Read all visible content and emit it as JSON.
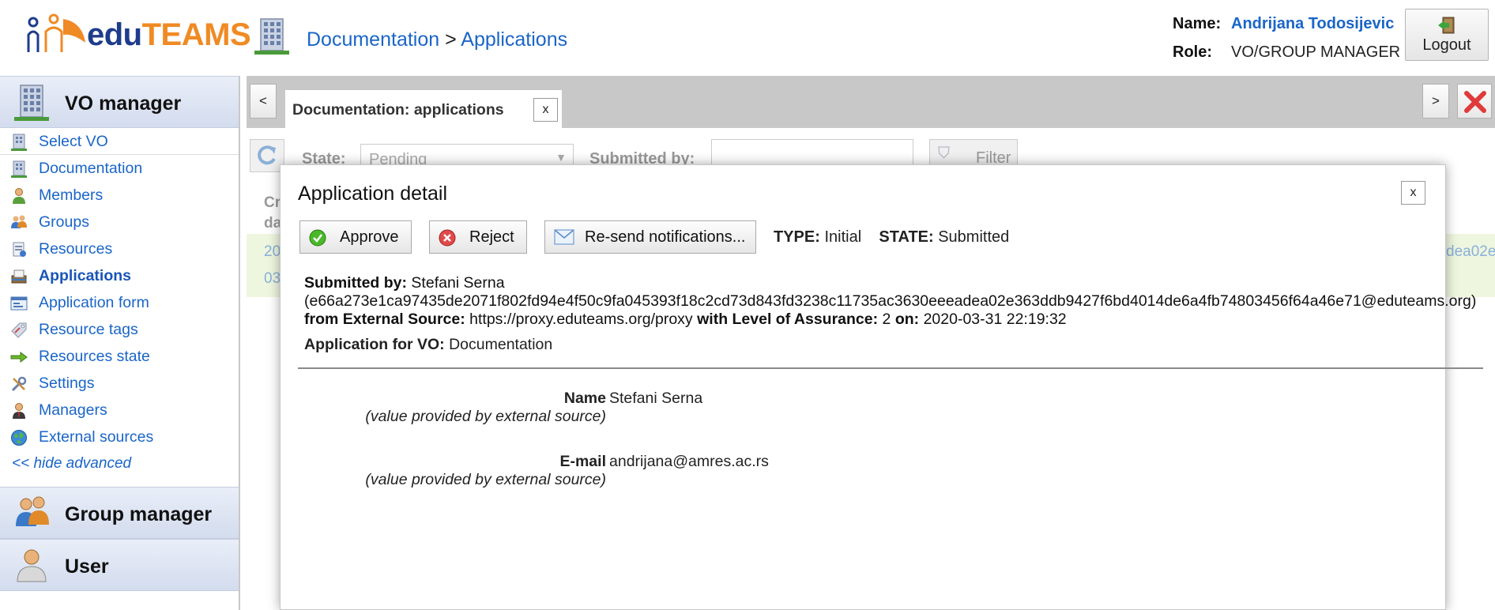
{
  "header": {
    "logo_edu": "edu",
    "logo_teams": "TEAMS",
    "breadcrumb_first": "Documentation",
    "breadcrumb_sep": ">",
    "breadcrumb_second": "Applications",
    "name_label": "Name:",
    "name_value": "Andrijana Todosijevic",
    "role_label": "Role:",
    "role_value": "VO/GROUP MANAGER",
    "logout_label": "Logout"
  },
  "sidebar": {
    "vo_manager": "VO manager",
    "items": [
      {
        "label": "Select VO",
        "icon": "building-icon"
      },
      {
        "label": "Documentation",
        "icon": "building-icon"
      },
      {
        "label": "Members",
        "icon": "user-icon"
      },
      {
        "label": "Groups",
        "icon": "group-icon"
      },
      {
        "label": "Resources",
        "icon": "resource-icon"
      },
      {
        "label": "Applications",
        "icon": "inbox-icon"
      },
      {
        "label": "Application form",
        "icon": "form-icon"
      },
      {
        "label": "Resource tags",
        "icon": "tag-icon"
      },
      {
        "label": "Resources state",
        "icon": "arrow-icon"
      },
      {
        "label": "Settings",
        "icon": "tools-icon"
      },
      {
        "label": "Managers",
        "icon": "manager-icon"
      },
      {
        "label": "External sources",
        "icon": "globe-icon"
      }
    ],
    "hide_advanced": "<< hide advanced",
    "group_manager": "Group manager",
    "user": "User"
  },
  "tabs": {
    "prev": "<",
    "next": ">",
    "active_tab": "Documentation: applications",
    "tab_close": "x"
  },
  "background": {
    "state_label": "State:",
    "state_value": "Pending",
    "submitted_by_label": "Submitted by:",
    "filter_label": "Filter",
    "col_header_1": "Cr",
    "col_header_2": "da",
    "row_c1": "20",
    "row_c2": "03",
    "row_right": "dea02e"
  },
  "modal": {
    "title": "Application detail",
    "close": "x",
    "approve": "Approve",
    "reject": "Reject",
    "resend": "Re-send notifications...",
    "type_label": "TYPE:",
    "type_value": "Initial",
    "state_label": "STATE:",
    "state_value": "Submitted",
    "submitted_by_label": "Submitted by:",
    "submitted_by_value": "Stefani Serna",
    "submitted_id": "(e66a273e1ca97435de2071f802fd94e4f50c9fa045393f18c2cd73d843fd3238c11735ac3630eeeadea02e363ddb9427f6bd4014de6a4fb74803456f64a46e71@eduteams.org)",
    "from_source_label": "from External Source:",
    "from_source_value": "https://proxy.eduteams.org/proxy",
    "loa_label": "with Level of Assurance:",
    "loa_value": "2",
    "on_label": "on:",
    "on_value": "2020-03-31 22:19:32",
    "app_for_vo_label": "Application for VO:",
    "app_for_vo_value": "Documentation",
    "fields": [
      {
        "label": "Name",
        "hint": "(value provided by external source)",
        "value": "Stefani Serna"
      },
      {
        "label": "E-mail",
        "hint": "(value provided by external source)",
        "value": "andrijana@amres.ac.rs"
      }
    ]
  },
  "colors": {
    "link": "#1a65c8",
    "logo_blue": "#1e3c8c",
    "logo_orange": "#f08a24",
    "sidebar_head": "#d3dcee",
    "row_green": "#eef6e0"
  }
}
